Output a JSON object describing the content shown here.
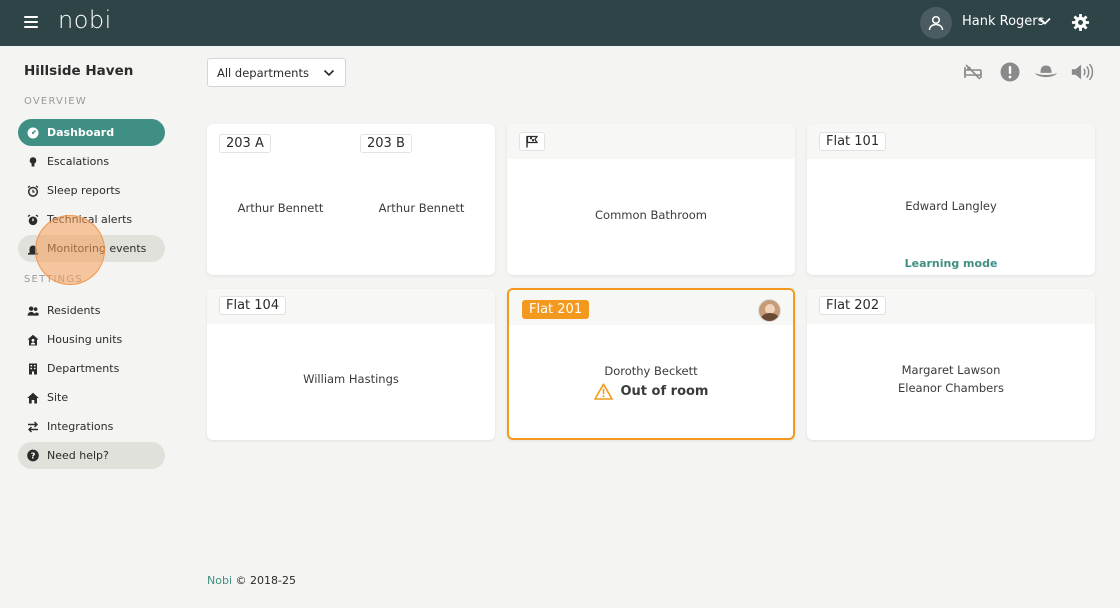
{
  "header": {
    "logo": "nobi",
    "user_name": "Hank Rogers"
  },
  "sidebar": {
    "site_name": "Hillside Haven",
    "overview_label": "OVERVIEW",
    "settings_label": "SETTINGS",
    "overview_items": [
      {
        "label": "Dashboard",
        "icon": "gauge-icon"
      },
      {
        "label": "Escalations",
        "icon": "lightbulb-icon"
      },
      {
        "label": "Sleep reports",
        "icon": "alarm-clock-icon"
      },
      {
        "label": "Technical alerts",
        "icon": "alarm-icon"
      },
      {
        "label": "Monitoring events",
        "icon": "siren-icon"
      }
    ],
    "settings_items": [
      {
        "label": "Residents",
        "icon": "people-icon"
      },
      {
        "label": "Housing units",
        "icon": "house-user-icon"
      },
      {
        "label": "Departments",
        "icon": "building-icon"
      },
      {
        "label": "Site",
        "icon": "home-icon"
      },
      {
        "label": "Integrations",
        "icon": "arrows-exchange-icon"
      }
    ],
    "help_label": "Need help?"
  },
  "toolbar": {
    "department_filter": "All departments"
  },
  "cards": {
    "c203": {
      "tag_a": "203 A",
      "tag_b": "203 B",
      "resident_a": "Arthur Bennett",
      "resident_b": "Arthur Bennett"
    },
    "common": {
      "resident": "Common Bathroom"
    },
    "f101": {
      "tag": "Flat 101",
      "resident": "Edward Langley",
      "status": "Learning mode"
    },
    "f104": {
      "tag": "Flat 104",
      "resident": "William Hastings"
    },
    "f201": {
      "tag": "Flat 201",
      "resident": "Dorothy Beckett",
      "alert": "Out of room"
    },
    "f202": {
      "tag": "Flat 202",
      "resident_1": "Margaret Lawson",
      "resident_2": "Eleanor Chambers"
    }
  },
  "footer": {
    "brand": "Nobi",
    "copyright": "© 2018-25"
  },
  "colors": {
    "header_bg": "#2f4447",
    "accent": "#3f8f84",
    "alert": "#f39a1e"
  }
}
